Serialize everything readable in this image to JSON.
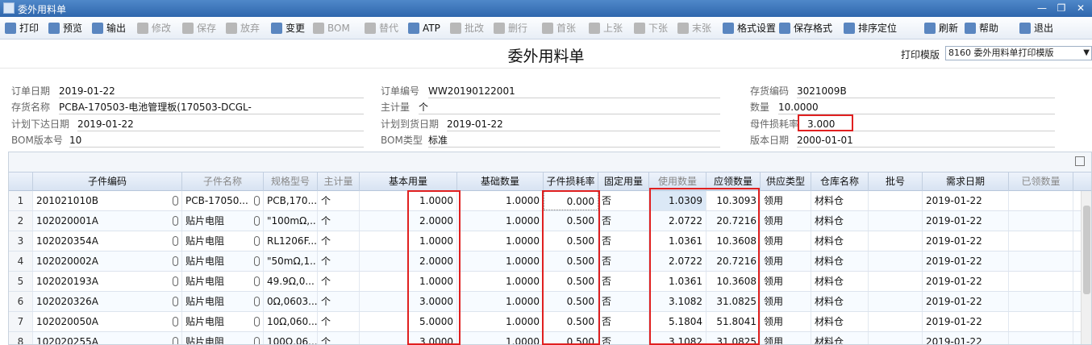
{
  "window": {
    "title": "委外用料单"
  },
  "toolbar": [
    {
      "label": "打印",
      "enabled": true,
      "icon": "printer-icon"
    },
    {
      "label": "预览",
      "enabled": true,
      "icon": "preview-icon"
    },
    {
      "label": "输出",
      "enabled": true,
      "icon": "export-icon"
    },
    {
      "label": "修改",
      "enabled": false,
      "icon": "edit-icon"
    },
    {
      "label": "保存",
      "enabled": false,
      "icon": "save-icon"
    },
    {
      "label": "放弃",
      "enabled": false,
      "icon": "discard-icon"
    },
    {
      "label": "变更",
      "enabled": true,
      "icon": "change-icon"
    },
    {
      "label": "BOM",
      "enabled": false,
      "icon": "bom-icon"
    },
    {
      "label": "替代",
      "enabled": false,
      "icon": "substitute-icon"
    },
    {
      "label": "ATP",
      "enabled": true,
      "icon": "atp-icon"
    },
    {
      "label": "批改",
      "enabled": false,
      "icon": "batch-edit-icon"
    },
    {
      "label": "删行",
      "enabled": false,
      "icon": "delete-row-icon"
    },
    {
      "label": "首张",
      "enabled": false,
      "icon": "first-icon"
    },
    {
      "label": "上张",
      "enabled": false,
      "icon": "prev-icon"
    },
    {
      "label": "下张",
      "enabled": false,
      "icon": "next-icon"
    },
    {
      "label": "末张",
      "enabled": false,
      "icon": "last-icon"
    },
    {
      "label": "格式设置",
      "enabled": true,
      "icon": "format-icon"
    },
    {
      "label": "保存格式",
      "enabled": true,
      "icon": "save-format-icon"
    },
    {
      "label": "排序定位",
      "enabled": true,
      "icon": "sort-icon"
    },
    {
      "label": "刷新",
      "enabled": true,
      "icon": "refresh-icon"
    },
    {
      "label": "帮助",
      "enabled": true,
      "icon": "help-icon"
    },
    {
      "label": "退出",
      "enabled": true,
      "icon": "exit-icon"
    }
  ],
  "title": {
    "text": "委外用料单",
    "template_label": "打印模版",
    "template_value": "8160 委外用料单打印模版"
  },
  "header": {
    "order_date": {
      "label": "订单日期",
      "value": "2019-01-22"
    },
    "order_no": {
      "label": "订单编号",
      "value": "WW20190122001"
    },
    "item_code": {
      "label": "存货编码",
      "value": "3021009B"
    },
    "item_name": {
      "label": "存货名称",
      "value": "PCBA-170503-电池管理板(170503-DCGL-"
    },
    "main_unit": {
      "label": "主计量",
      "value": "个"
    },
    "quantity": {
      "label": "数量",
      "value": "10.0000"
    },
    "plan_issue_date": {
      "label": "计划下达日期",
      "value": "2019-01-22"
    },
    "plan_arrival_date": {
      "label": "计划到货日期",
      "value": "2019-01-22"
    },
    "parent_loss_rate": {
      "label": "母件损耗率",
      "value": "3.000"
    },
    "bom_version": {
      "label": "BOM版本号",
      "value": "10"
    },
    "bom_type": {
      "label": "BOM类型",
      "value": "标准"
    },
    "version_date": {
      "label": "版本日期",
      "value": "2000-01-01"
    }
  },
  "grid": {
    "columns": [
      "子件编码",
      "子件名称",
      "规格型号",
      "主计量",
      "基本用量",
      "基础数量",
      "子件损耗率",
      "固定用量",
      "使用数量",
      "应领数量",
      "供应类型",
      "仓库名称",
      "批号",
      "需求日期",
      "已领数量"
    ],
    "rows": [
      [
        "1",
        "201021010B",
        "PCB-17050...",
        "PCB,170...",
        "个",
        "1.0000",
        "1.0000",
        "0.000",
        "否",
        "1.0309",
        "10.3093",
        "领用",
        "材料仓",
        "",
        "2019-01-22",
        ""
      ],
      [
        "2",
        "102020001A",
        "贴片电阻",
        "\"100mΩ,...",
        "个",
        "2.0000",
        "1.0000",
        "0.500",
        "否",
        "2.0722",
        "20.7216",
        "领用",
        "材料仓",
        "",
        "2019-01-22",
        ""
      ],
      [
        "3",
        "102020354A",
        "贴片电阻",
        "RL1206F...",
        "个",
        "1.0000",
        "1.0000",
        "0.500",
        "否",
        "1.0361",
        "10.3608",
        "领用",
        "材料仓",
        "",
        "2019-01-22",
        ""
      ],
      [
        "4",
        "102020002A",
        "贴片电阻",
        "\"50mΩ,1...",
        "个",
        "2.0000",
        "1.0000",
        "0.500",
        "否",
        "2.0722",
        "20.7216",
        "领用",
        "材料仓",
        "",
        "2019-01-22",
        ""
      ],
      [
        "5",
        "102020193A",
        "贴片电阻",
        "49.9Ω,0...",
        "个",
        "1.0000",
        "1.0000",
        "0.500",
        "否",
        "1.0361",
        "10.3608",
        "领用",
        "材料仓",
        "",
        "2019-01-22",
        ""
      ],
      [
        "6",
        "102020326A",
        "贴片电阻",
        "0Ω,0603...",
        "个",
        "3.0000",
        "1.0000",
        "0.500",
        "否",
        "3.1082",
        "31.0825",
        "领用",
        "材料仓",
        "",
        "2019-01-22",
        ""
      ],
      [
        "7",
        "102020050A",
        "贴片电阻",
        "10Ω,060...",
        "个",
        "5.0000",
        "1.0000",
        "0.500",
        "否",
        "5.1804",
        "51.8041",
        "领用",
        "材料仓",
        "",
        "2019-01-22",
        ""
      ],
      [
        "8",
        "102020255A",
        "贴片电阻",
        "100Ω,06...",
        "个",
        "3.0000",
        "1.0000",
        "0.500",
        "否",
        "3.1082",
        "31.0825",
        "领用",
        "材料仓",
        "",
        "2019-01-22",
        ""
      ]
    ]
  },
  "colors": {
    "highlight": "#e02020",
    "title_bar": "#3a73b8"
  }
}
